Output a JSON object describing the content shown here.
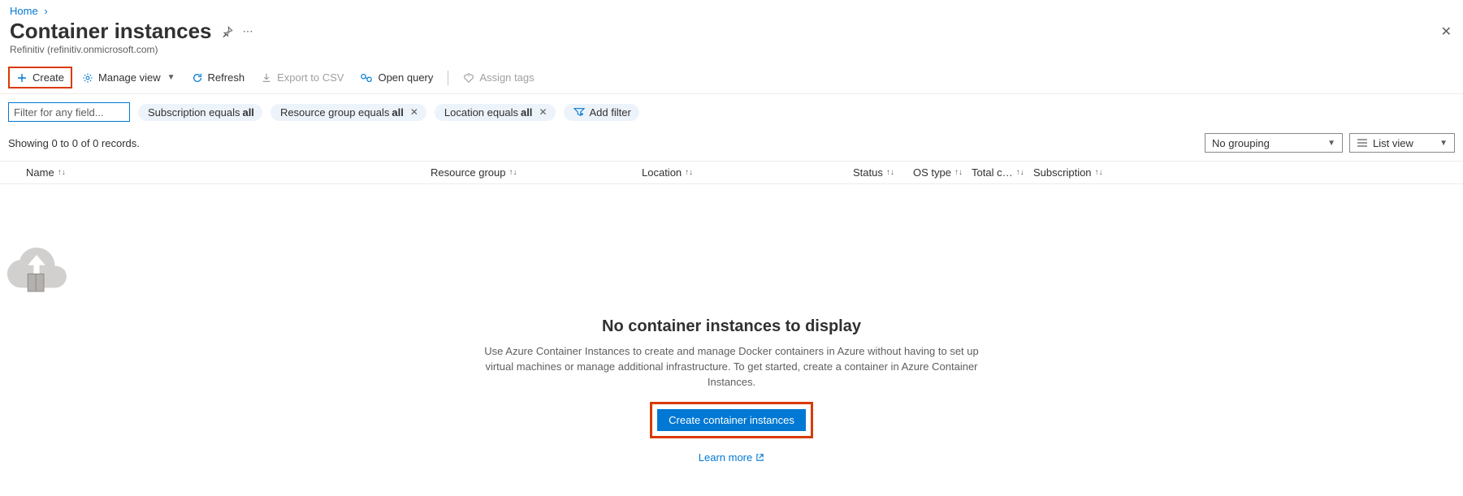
{
  "breadcrumb": {
    "home": "Home"
  },
  "page": {
    "title": "Container instances",
    "subtitle": "Refinitiv (refinitiv.onmicrosoft.com)"
  },
  "toolbar": {
    "create": "Create",
    "manage_view": "Manage view",
    "refresh": "Refresh",
    "export_csv": "Export to CSV",
    "open_query": "Open query",
    "assign_tags": "Assign tags"
  },
  "filters": {
    "input_placeholder": "Filter for any field...",
    "subscription_label": "Subscription equals",
    "subscription_value": "all",
    "resource_group_label": "Resource group equals",
    "resource_group_value": "all",
    "location_label": "Location equals",
    "location_value": "all",
    "add_filter": "Add filter"
  },
  "records": {
    "showing_text": "Showing 0 to 0 of 0 records.",
    "grouping": "No grouping",
    "view_mode": "List view"
  },
  "columns": {
    "name": "Name",
    "resource_group": "Resource group",
    "location": "Location",
    "status": "Status",
    "os_type": "OS type",
    "total_containers": "Total c…",
    "subscription": "Subscription"
  },
  "empty": {
    "title": "No container instances to display",
    "description": "Use Azure Container Instances to create and manage Docker containers in Azure without having to set up virtual machines or manage additional infrastructure. To get started, create a container in Azure Container Instances.",
    "cta": "Create container instances",
    "learn_more": "Learn more"
  }
}
